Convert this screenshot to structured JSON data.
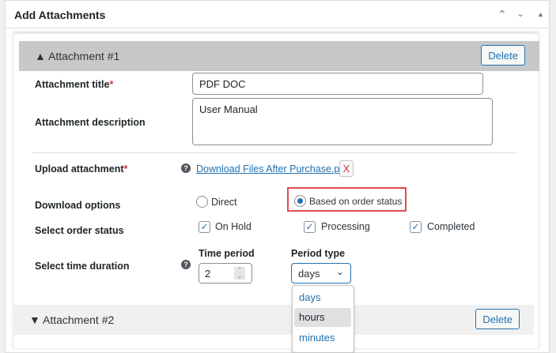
{
  "panel": {
    "title": "Add Attachments",
    "up": "^",
    "down": "v",
    "toggle": "▲"
  },
  "attachments": [
    {
      "title": "Attachment #1",
      "arrow": "▲",
      "delete": "Delete"
    },
    {
      "title": "Attachment #2",
      "arrow": "▼",
      "delete": "Delete"
    }
  ],
  "form": {
    "title_label": "Attachment title",
    "title_value": "PDF DOC",
    "desc_label": "Attachment description",
    "desc_value": "User Manual",
    "upload_label": "Upload attachment",
    "file_link": "Download Files After Purchase.pdf",
    "remove": "X",
    "download_label": "Download options",
    "opt_direct": "Direct",
    "opt_status": "Based on order status",
    "status_label": "Select order status",
    "statuses": [
      "On Hold",
      "Processing",
      "Completed"
    ],
    "duration_label": "Select time duration",
    "period_label": "Time period",
    "period_value": "2",
    "type_label": "Period type",
    "type_value": "days",
    "type_options": [
      "days",
      "hours",
      "minutes"
    ],
    "required": "*",
    "help": "?"
  },
  "colors": {
    "accent": "#2271b1",
    "highlight": "#d63638"
  }
}
